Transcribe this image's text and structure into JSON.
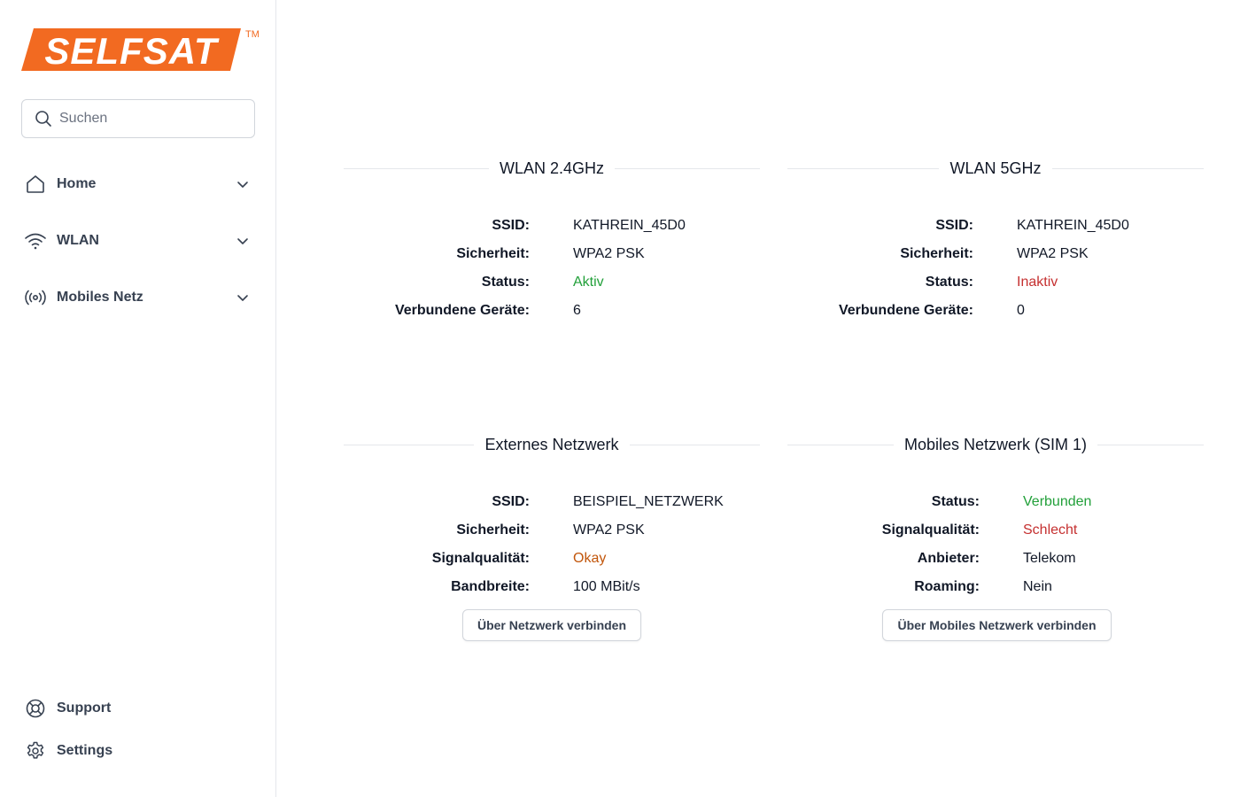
{
  "brand": {
    "name": "SELFSAT",
    "tm": "TM",
    "color": "#f26a21"
  },
  "search": {
    "placeholder": "Suchen",
    "icon": "search-icon"
  },
  "nav": [
    {
      "label": "Home",
      "icon": "home-icon"
    },
    {
      "label": "WLAN",
      "icon": "wifi-icon"
    },
    {
      "label": "Mobiles Netz",
      "icon": "radio-signal-icon"
    }
  ],
  "footer_nav": [
    {
      "label": "Support",
      "icon": "lifebuoy-icon"
    },
    {
      "label": "Settings",
      "icon": "gear-icon"
    }
  ],
  "cards": {
    "wlan24": {
      "title": "WLAN 2.4GHz",
      "ssid_label": "SSID:",
      "ssid": "KATHREIN_45D0",
      "security_label": "Sicherheit:",
      "security": "WPA2 PSK",
      "status_label": "Status:",
      "status": "Aktiv",
      "devices_label": "Verbundene Geräte:",
      "devices": "6"
    },
    "wlan5": {
      "title": "WLAN 5GHz",
      "ssid_label": "SSID:",
      "ssid": "KATHREIN_45D0",
      "security_label": "Sicherheit:",
      "security": "WPA2 PSK",
      "status_label": "Status:",
      "status": "Inaktiv",
      "devices_label": "Verbundene Geräte:",
      "devices": "0"
    },
    "external": {
      "title": "Externes Netzwerk",
      "ssid_label": "SSID:",
      "ssid": "BEISPIEL_NETZWERK",
      "security_label": "Sicherheit:",
      "security": "WPA2 PSK",
      "signal_label": "Signalqualität:",
      "signal": "Okay",
      "bandwidth_label": "Bandbreite:",
      "bandwidth": "100 MBit/s",
      "button": "Über Netzwerk verbinden"
    },
    "mobile": {
      "title": "Mobiles Netzwerk (SIM 1)",
      "status_label": "Status:",
      "status": "Verbunden",
      "signal_label": "Signalqualität:",
      "signal": "Schlecht",
      "provider_label": "Anbieter:",
      "provider": "Telekom",
      "roaming_label": "Roaming:",
      "roaming": "Nein",
      "button": "Über Mobiles Netzwerk verbinden"
    }
  },
  "colors": {
    "green": "#22a03a",
    "red": "#c53030",
    "orange": "#c2560b"
  }
}
